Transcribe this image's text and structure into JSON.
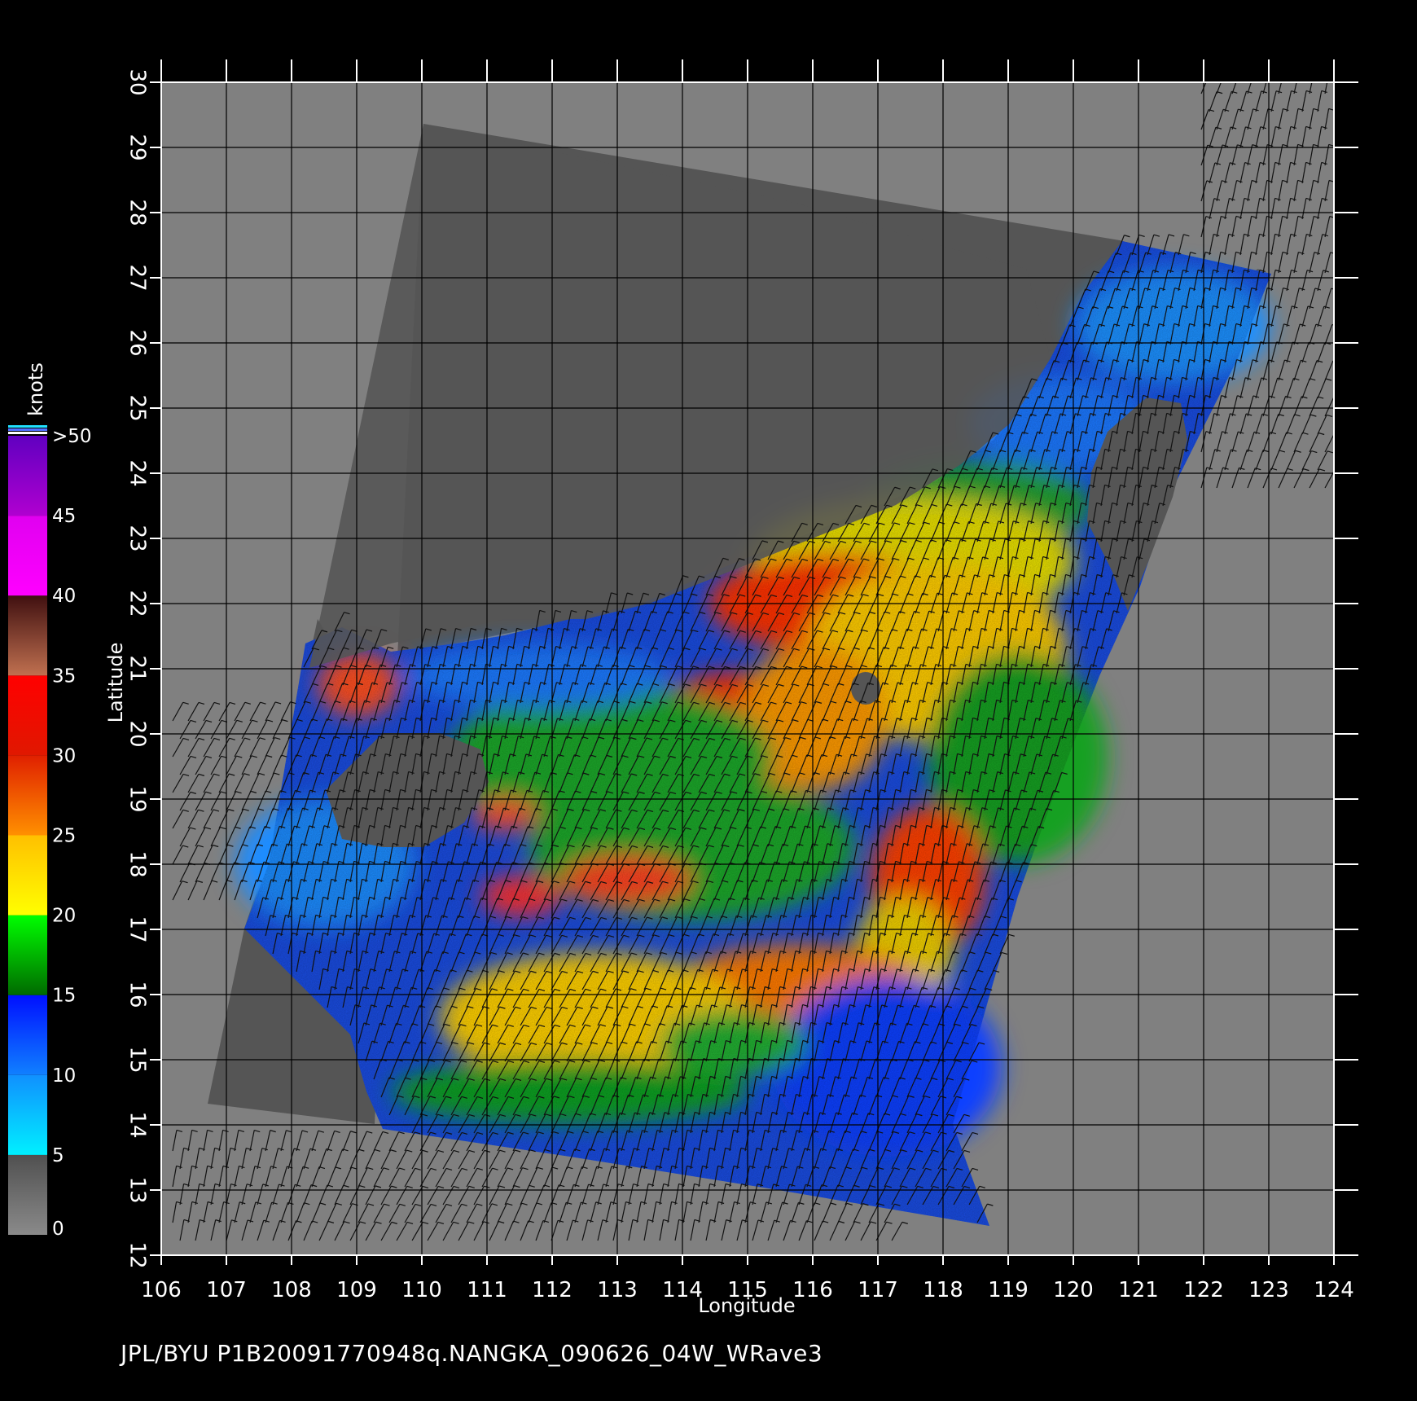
{
  "map": {
    "x_axis_title": "Longitude",
    "y_axis_title": "Latitude",
    "lon_ticks": [
      "106",
      "107",
      "108",
      "109",
      "110",
      "111",
      "112",
      "113",
      "114",
      "115",
      "116",
      "117",
      "118",
      "119",
      "120",
      "121",
      "122",
      "123",
      "124"
    ],
    "lat_ticks": [
      "12",
      "13",
      "14",
      "15",
      "16",
      "17",
      "18",
      "19",
      "20",
      "21",
      "22",
      "23",
      "24",
      "25",
      "26",
      "27",
      "28",
      "29",
      "30"
    ],
    "lon_range": [
      106,
      124
    ],
    "lat_range": [
      12,
      30
    ]
  },
  "legend": {
    "unit": "knots",
    "labels": [
      "0",
      "5",
      "10",
      "15",
      "20",
      "25",
      "30",
      "35",
      "40",
      "45",
      ">50"
    ],
    "bands": [
      {
        "from": 0,
        "to": 5,
        "top": "#505050",
        "bottom": "#8a8a8a"
      },
      {
        "from": 5,
        "to": 10,
        "top": "#1090ff",
        "bottom": "#00f0ff"
      },
      {
        "from": 10,
        "to": 15,
        "top": "#0010ff",
        "bottom": "#1080ff"
      },
      {
        "from": 15,
        "to": 20,
        "top": "#00ff00",
        "bottom": "#006a00"
      },
      {
        "from": 20,
        "to": 25,
        "top": "#ffc000",
        "bottom": "#ffff00"
      },
      {
        "from": 25,
        "to": 30,
        "top": "#e02000",
        "bottom": "#ff9000"
      },
      {
        "from": 30,
        "to": 35,
        "top": "#ff0000",
        "bottom": "#e01800"
      },
      {
        "from": 35,
        "to": 40,
        "top": "#401010",
        "bottom": "#c07050"
      },
      {
        "from": 40,
        "to": 45,
        "top": "#e000f0",
        "bottom": "#ff00ff"
      },
      {
        "from": 45,
        "to": 50,
        "top": "#6000c0",
        "bottom": "#b000d0"
      }
    ]
  },
  "colors": {
    "background": "#000000",
    "plot_area": "#808080",
    "land": "#555555",
    "gridline": "#000000",
    "tick": "#ffffff"
  },
  "caption": "JPL/BYU  P1B20091770948q.NANGKA_090626_04W_WRave3"
}
